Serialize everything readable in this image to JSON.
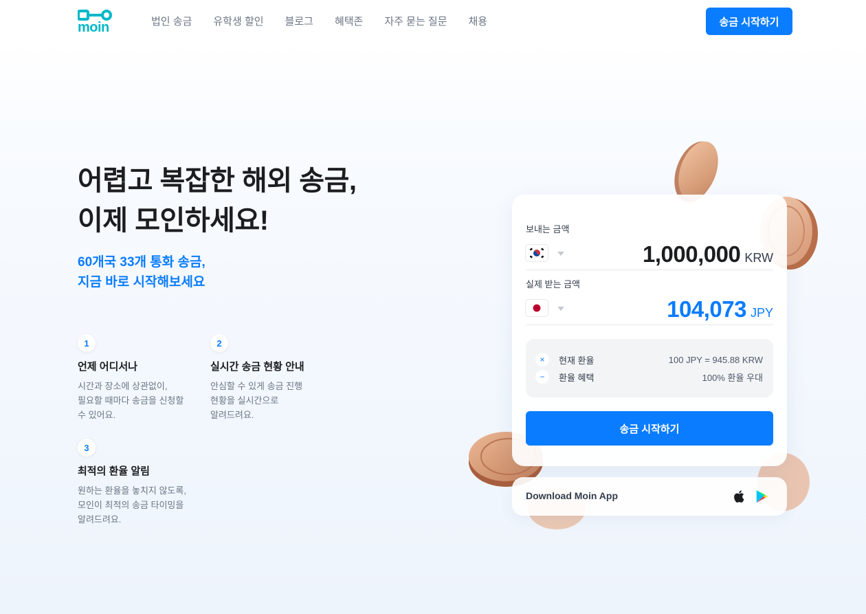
{
  "brand": {
    "logo_text": "moin",
    "accent": "#0a7cff"
  },
  "nav": {
    "items": [
      "법인 송금",
      "유학생 할인",
      "블로그",
      "혜택존",
      "자주 묻는 질문",
      "채용"
    ],
    "cta": "송금 시작하기"
  },
  "hero": {
    "title_line1": "어렵고 복잡한 해외 송금,",
    "title_line2": "이제 모인하세요!",
    "sub_line1": "60개국 33개 통화 송금,",
    "sub_line2": "지금 바로 시작해보세요"
  },
  "features": [
    {
      "num": "1",
      "title": "언제 어디서나",
      "desc": "시간과 장소에 상관없이,\n필요할 때마다 송금을 신청할\n수 있어요."
    },
    {
      "num": "2",
      "title": "실시간 송금 현황 안내",
      "desc": "안심할 수 있게 송금 진행\n현황을 실시간으로\n알려드려요."
    },
    {
      "num": "3",
      "title": "최적의 환율 알림",
      "desc": "원하는 환율을 놓치지 않도록,\n모인이 최적의 송금 타이밍을\n알려드려요."
    }
  ],
  "calculator": {
    "send_label": "보내는 금액",
    "send_amount": "1,000,000",
    "send_currency": "KRW",
    "send_flag": "south-korea-flag-icon",
    "receive_label": "실제 받는 금액",
    "receive_amount": "104,073",
    "receive_currency": "JPY",
    "receive_flag": "japan-flag-icon",
    "rate_label": "현재 환율",
    "rate_value": "100 JPY = 945.88 KRW",
    "benefit_label": "환율 혜택",
    "benefit_value": "100% 환율 우대",
    "rate_icon_symbol": "×",
    "benefit_icon_symbol": "−",
    "cta": "송금 시작하기"
  },
  "app_bar": {
    "label": "Download Moin App",
    "icons": [
      "apple-icon",
      "google-play-icon"
    ]
  }
}
